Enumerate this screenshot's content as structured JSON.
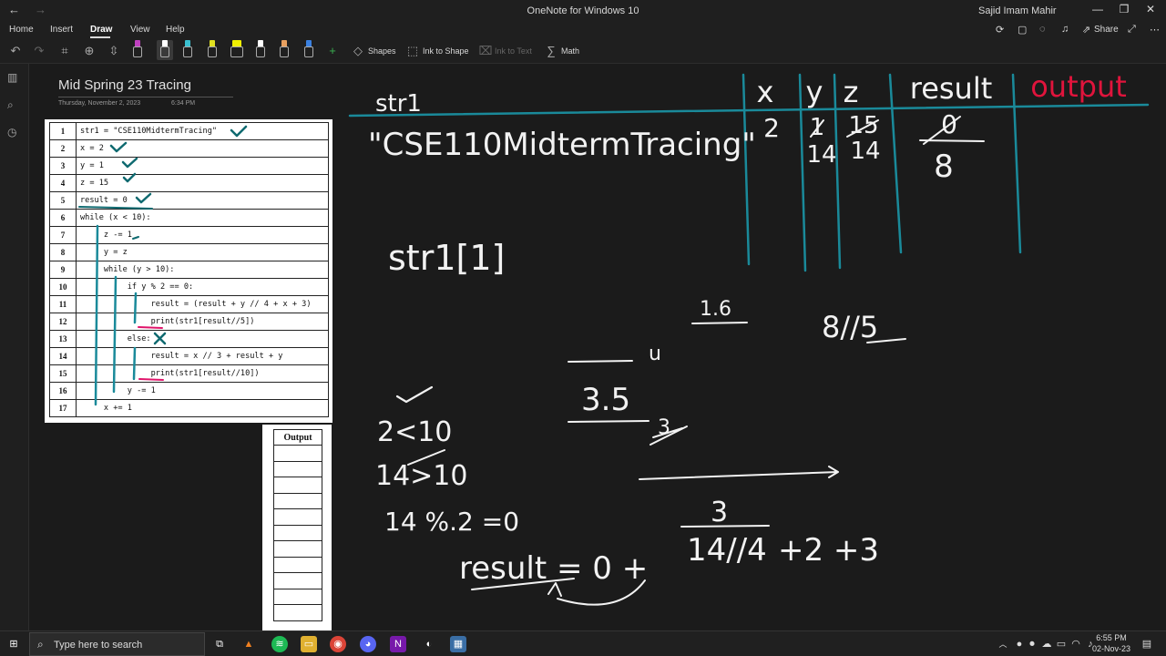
{
  "window": {
    "title": "OneNote for Windows 10",
    "user": "Sajid Imam  Mahir",
    "back_glyph": "←",
    "forward_glyph": "→",
    "minimize_glyph": "—",
    "restore_glyph": "❐",
    "close_glyph": "✕"
  },
  "menu": {
    "tabs": [
      "Home",
      "Insert",
      "Draw",
      "View",
      "Help"
    ],
    "active": "Draw",
    "share_label": "Share"
  },
  "toolbar": {
    "shapes_label": "Shapes",
    "ink_to_shape_label": "Ink to Shape",
    "ink_to_text_label": "Ink to Text",
    "math_label": "Math",
    "pen_colors": [
      "#c040c0",
      "#ffffff",
      "#3ac0d0",
      "#e0e020",
      "#f0f000",
      "#ffffff",
      "#e8a060",
      "#3a80e0"
    ]
  },
  "page": {
    "title": "Mid Spring 23 Tracing",
    "date": "Thursday, November 2, 2023",
    "time": "6:34 PM"
  },
  "code": {
    "lines": [
      {
        "n": "1",
        "text": "str1 = \"CSE110MidtermTracing\""
      },
      {
        "n": "2",
        "text": "x = 2"
      },
      {
        "n": "3",
        "text": "y = 1"
      },
      {
        "n": "4",
        "text": "z = 15"
      },
      {
        "n": "5",
        "text": "result = 0"
      },
      {
        "n": "6",
        "text": "while (x < 10):"
      },
      {
        "n": "7",
        "text": "     z -= 1"
      },
      {
        "n": "8",
        "text": "     y = z"
      },
      {
        "n": "9",
        "text": "     while (y > 10):"
      },
      {
        "n": "10",
        "text": "          if y % 2 == 0:"
      },
      {
        "n": "11",
        "text": "               result = (result + y // 4 + x + 3)"
      },
      {
        "n": "12",
        "text": "               print(str1[result//5])"
      },
      {
        "n": "13",
        "text": "          else:"
      },
      {
        "n": "14",
        "text": "               result = x // 3 + result + y"
      },
      {
        "n": "15",
        "text": "               print(str1[result//10])"
      },
      {
        "n": "16",
        "text": "          y -= 1"
      },
      {
        "n": "17",
        "text": "     x += 1"
      }
    ]
  },
  "output_table": {
    "header": "Output",
    "rows": 11
  },
  "ink": {
    "str1_label": "str1",
    "str1_value": "\"CSE110MidtermTracing\"",
    "col_x": "x",
    "col_y": "y",
    "col_z": "z",
    "col_result": "result",
    "col_output": "output",
    "x_val": "2",
    "y_old": "1",
    "y_new": "14",
    "z_old": "15",
    "z_new": "14",
    "result_old": "0",
    "result_new": "8",
    "index_expr": "str1[1]",
    "frac_16": "1.6",
    "div_expr": "8//5",
    "frac_u": "u",
    "frac_35": "3.5",
    "frac_3": "3",
    "cond1": "2<10",
    "cond2": "14>10",
    "mod_expr": "14 %.2 =0",
    "result_expr_left": "result = 0 +",
    "result_expr_mid": "14//4",
    "result_expr_right": "+2 +3",
    "result_expr_above": "3",
    "ink_colors": {
      "white": "#f2f2f2",
      "teal": "#1a8a9a",
      "red": "#e0143c",
      "darkteal": "#0f6a70",
      "pink": "#e0146a"
    }
  },
  "taskbar": {
    "search_placeholder": "Type here to search",
    "time": "6:55 PM",
    "date": "02-Nov-23"
  }
}
